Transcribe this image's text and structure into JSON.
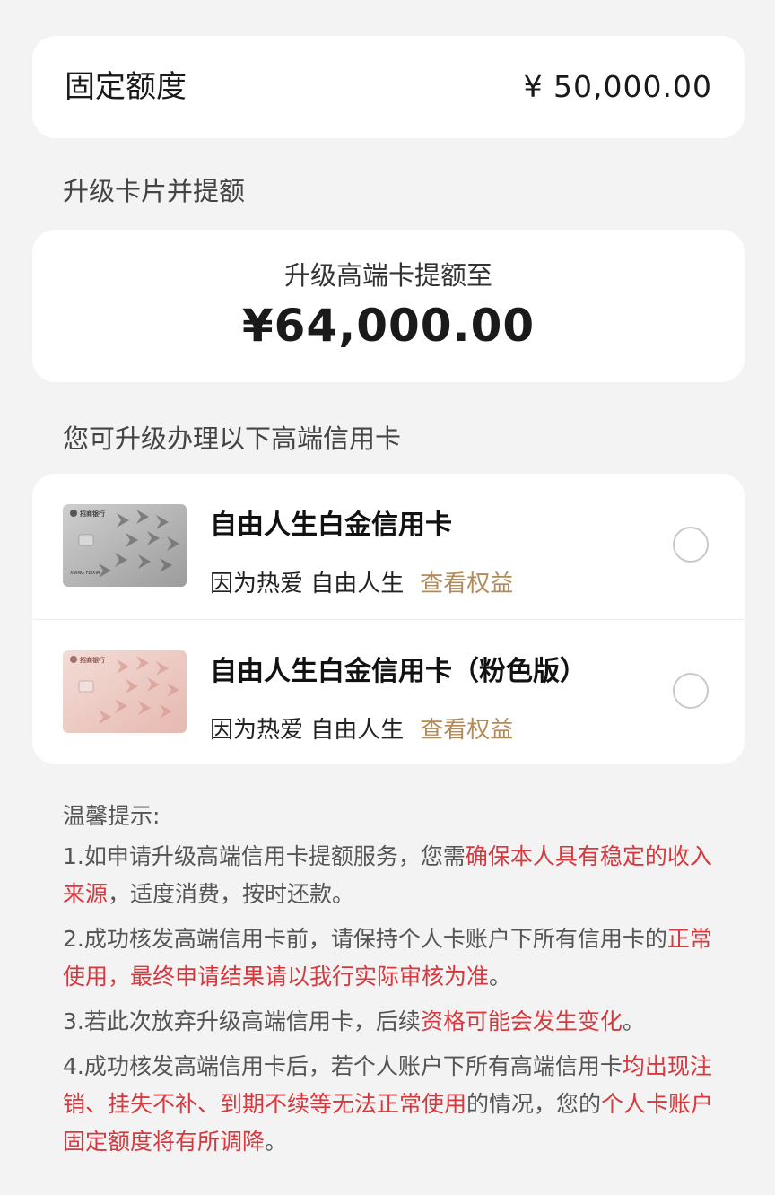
{
  "fixed_limit": {
    "label": "固定额度",
    "amount": "¥ 50,000.00"
  },
  "upgrade_section": {
    "title": "升级卡片并提额",
    "subtitle": "升级高端卡提额至",
    "amount": "¥64,000.00"
  },
  "cards_section": {
    "title": "您可升级办理以下高端信用卡",
    "options": [
      {
        "name": "自由人生白金信用卡",
        "slogan": "因为热爱 自由人生",
        "link": "查看权益",
        "selected": false
      },
      {
        "name": "自由人生白金信用卡（粉色版）",
        "slogan": "因为热爱 自由人生",
        "link": "查看权益",
        "selected": false
      }
    ]
  },
  "tips": {
    "title": "温馨提示:",
    "items": [
      {
        "a": "1.如申请升级高端信用卡提额服务，您需",
        "red": "确保本人具有稳定的收入来源",
        "b": "，适度消费，按时还款。"
      },
      {
        "a": "2.成功核发高端信用卡前，请保持个人卡账户下所有信用卡的",
        "red": "正常使用，最终申请结果请以我行实际审核为准",
        "b": "。"
      },
      {
        "a": "3.若此次放弃升级高端信用卡，后续",
        "red": "资格可能会发生变化",
        "b": "。"
      },
      {
        "a": "4.成功核发高端信用卡后，若个人账户下所有高端信用卡",
        "red": "均出现注销、挂失不补、到期不续等无法正常使用",
        "b": "的情况，您的",
        "red2": "个人卡账户固定额度将有所调降",
        "c": "。"
      }
    ]
  },
  "colors": {
    "background": "#f3f3f3",
    "link": "#b38a5a",
    "warning": "#d6383d"
  },
  "card_art_text": {
    "bank": "招商银行",
    "holder": "XIANG FEIXIA"
  }
}
